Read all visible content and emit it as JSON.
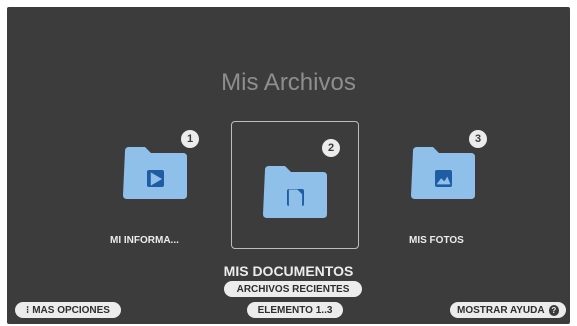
{
  "header": {
    "title": "Mis Archivos"
  },
  "items": [
    {
      "badge": "1",
      "label": "MI INFORMA...",
      "icon": "video-folder-icon"
    },
    {
      "badge": "2",
      "label": "MIS DOCUMENTOS",
      "icon": "document-folder-icon",
      "selected": true
    },
    {
      "badge": "3",
      "label": "MIS FOTOS",
      "icon": "photo-folder-icon"
    }
  ],
  "selected_subtitle": "ARCHIVOS RECIENTES",
  "footer": {
    "more_options": "MAS OPCIONES",
    "position": "ELEMENTO 1..3",
    "help": "MOSTRAR AYUDA",
    "help_icon_glyph": "?",
    "more_icon_glyph": "⁝"
  },
  "colors": {
    "background": "#3c3c3c",
    "folder": "#8fc0ea",
    "folder_glyph": "#1f5da3",
    "text": "#ececec"
  }
}
